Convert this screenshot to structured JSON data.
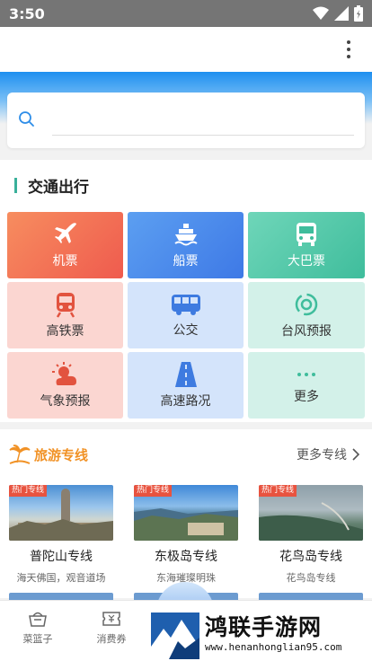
{
  "status_bar": {
    "time": "3:50"
  },
  "search": {
    "placeholder": "",
    "value": ""
  },
  "transport": {
    "title": "交通出行",
    "tiles": [
      {
        "label": "机票",
        "icon": "plane-icon"
      },
      {
        "label": "船票",
        "icon": "ship-icon"
      },
      {
        "label": "大巴票",
        "icon": "bus-icon"
      },
      {
        "label": "高铁票",
        "icon": "train-icon"
      },
      {
        "label": "公交",
        "icon": "city-bus-icon"
      },
      {
        "label": "台风预报",
        "icon": "typhoon-icon"
      },
      {
        "label": "气象预报",
        "icon": "weather-icon"
      },
      {
        "label": "高速路况",
        "icon": "highway-icon"
      },
      {
        "label": "更多",
        "icon": "more-dots-icon"
      }
    ],
    "colors": {
      "accent_bar": "#39b09a",
      "plane": "#ef5b4e",
      "ship": "#3e79e6",
      "bus": "#3fbd9c"
    }
  },
  "tour": {
    "title": "旅游专线",
    "more_label": "更多专线",
    "cards": [
      {
        "badge": "热门专线",
        "name": "普陀山专线",
        "subtitle": "海天佛国，观音道场"
      },
      {
        "badge": "热门专线",
        "name": "东极岛专线",
        "subtitle": "东海璀璨明珠"
      },
      {
        "badge": "热门专线",
        "name": "花鸟岛专线",
        "subtitle": "花鸟岛专线"
      }
    ]
  },
  "bottom_nav": {
    "items": [
      {
        "label": "菜篮子"
      },
      {
        "label": "消费券"
      }
    ]
  },
  "watermark": {
    "title": "鸿联手游网",
    "url": "www.henanhonglian95.com"
  }
}
